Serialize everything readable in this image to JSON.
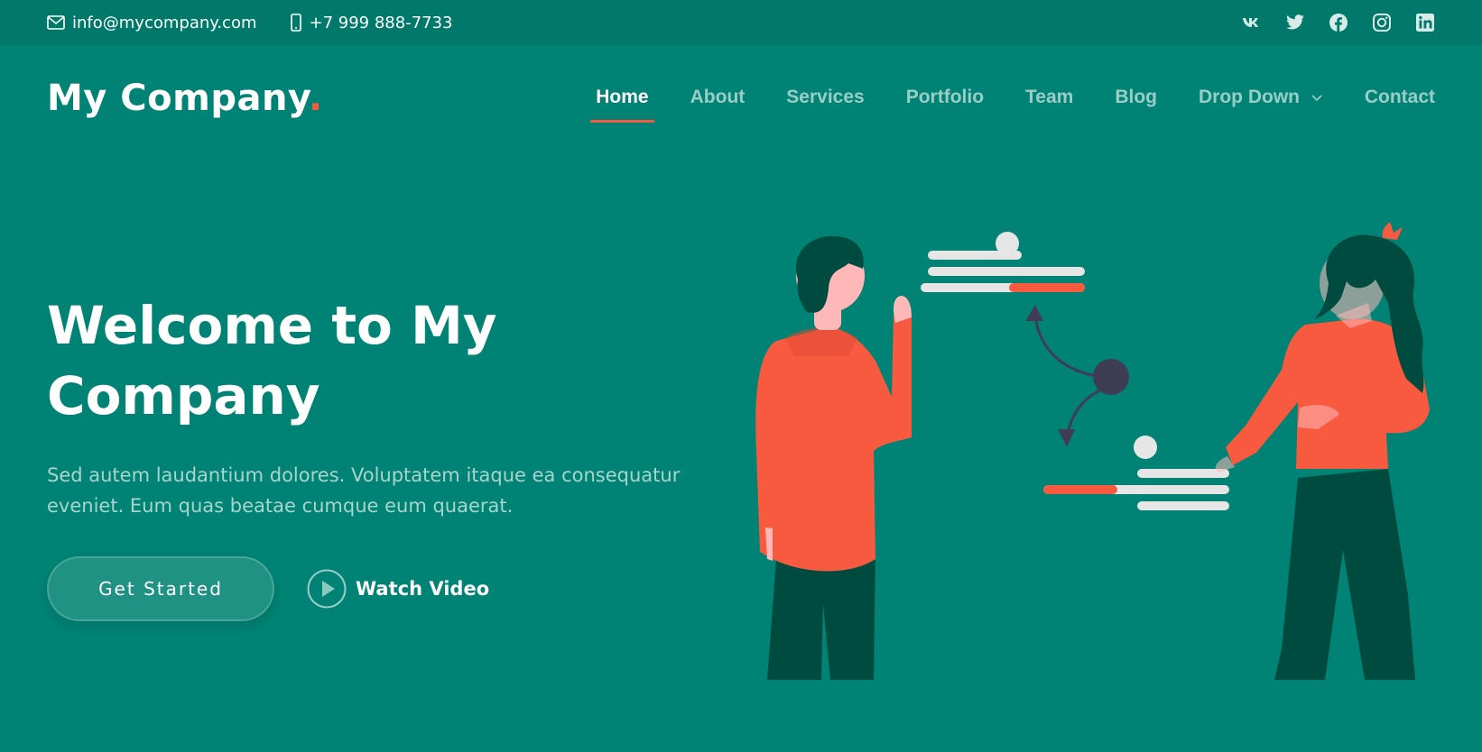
{
  "topbar": {
    "email": "info@mycompany.com",
    "phone": "+7 999 888-7733",
    "social_icons": [
      "vk-icon",
      "twitter-icon",
      "facebook-icon",
      "instagram-icon",
      "linkedin-icon"
    ]
  },
  "header": {
    "logo_text": "My Company",
    "logo_dot": ".",
    "nav": [
      {
        "label": "Home",
        "active": true
      },
      {
        "label": "About"
      },
      {
        "label": "Services"
      },
      {
        "label": "Portfolio"
      },
      {
        "label": "Team"
      },
      {
        "label": "Blog"
      },
      {
        "label": "Drop Down",
        "has_dropdown": true
      },
      {
        "label": "Contact"
      }
    ]
  },
  "hero": {
    "title": "Welcome to My Company",
    "text": "Sed autem laudantium dolores. Voluptatem itaque ea consequatur eveniet. Eum quas beatae cumque eum quaerat.",
    "cta_label": "Get Started",
    "video_label": "Watch Video"
  },
  "colors": {
    "background": "#008374",
    "topbar": "#00796b",
    "accent": "#f85a40",
    "dark_green": "#004b40"
  }
}
